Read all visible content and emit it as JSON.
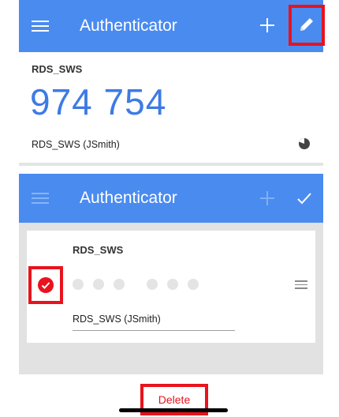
{
  "top_panel": {
    "app_title": "Authenticator",
    "account": {
      "issuer": "RDS_SWS",
      "code": "974 754",
      "name": "RDS_SWS (JSmith)"
    }
  },
  "edit_panel": {
    "app_title": "Authenticator",
    "account": {
      "issuer": "RDS_SWS",
      "name": "RDS_SWS (JSmith)"
    },
    "delete_label": "Delete"
  },
  "colors": {
    "app_bar": "#4a8bf0",
    "highlight": "#e8131d",
    "code_text": "#3d7be4"
  },
  "icons": [
    "menu-icon",
    "plus-icon",
    "pencil-icon",
    "timer-icon",
    "check-icon",
    "drag-handle-icon"
  ]
}
